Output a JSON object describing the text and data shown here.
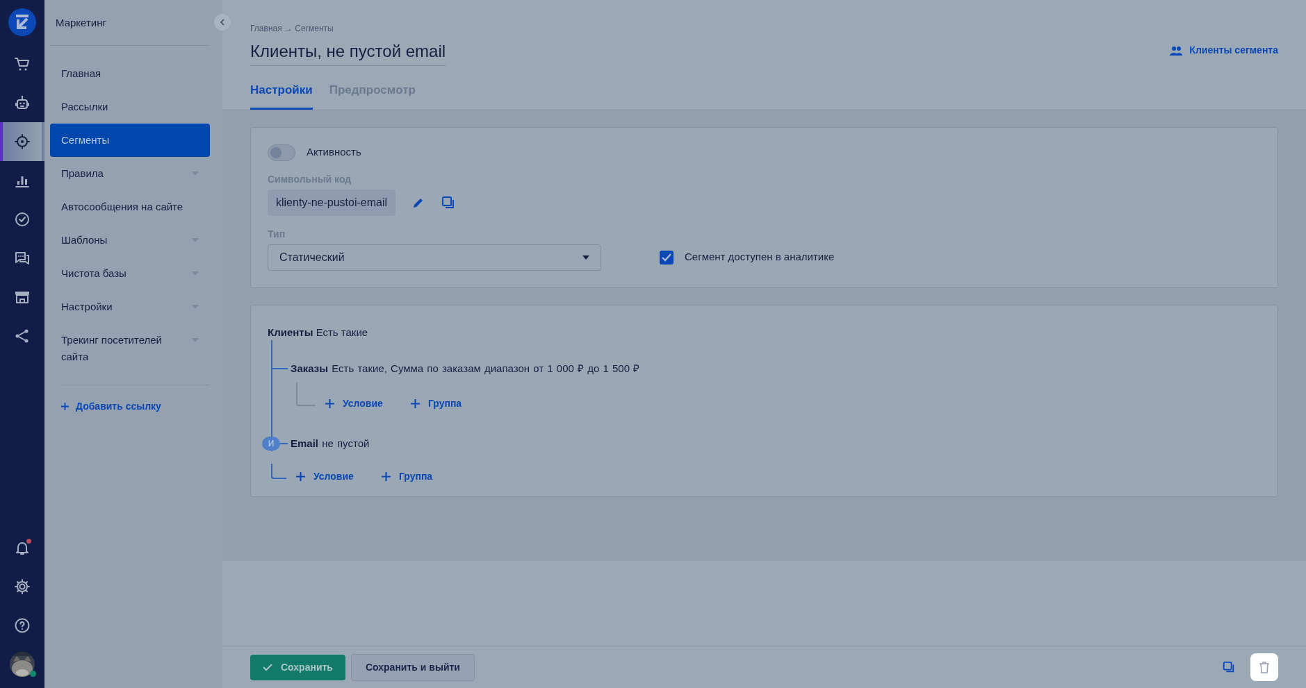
{
  "rail": {
    "items": [
      {
        "kind": "cart",
        "selected": false
      },
      {
        "kind": "robot",
        "selected": false
      },
      {
        "kind": "target",
        "selected": true
      },
      {
        "kind": "chart",
        "selected": false
      },
      {
        "kind": "check",
        "selected": false
      },
      {
        "kind": "chat",
        "selected": false
      },
      {
        "kind": "store",
        "selected": false
      },
      {
        "kind": "share",
        "selected": false
      }
    ],
    "bottom": [
      {
        "kind": "bell",
        "notification": true
      },
      {
        "kind": "gear",
        "notification": false
      },
      {
        "kind": "help",
        "notification": false
      },
      {
        "kind": "avatar",
        "notification": true
      }
    ]
  },
  "sidebar": {
    "title": "Маркетинг",
    "items": [
      {
        "label": "Главная",
        "selected": false,
        "expandable": false
      },
      {
        "label": "Рассылки",
        "selected": false,
        "expandable": false
      },
      {
        "label": "Сегменты",
        "selected": true,
        "expandable": false
      },
      {
        "label": "Правила",
        "selected": false,
        "expandable": true
      },
      {
        "label": "Автосообщения на сайте",
        "selected": false,
        "expandable": false
      },
      {
        "label": "Шаблоны",
        "selected": false,
        "expandable": true
      },
      {
        "label": "Чистота базы",
        "selected": false,
        "expandable": true
      },
      {
        "label": "Настройки",
        "selected": false,
        "expandable": true
      },
      {
        "label": "Трекинг посетителей сайта",
        "selected": false,
        "expandable": true
      }
    ],
    "add_link": "Добавить ссылку"
  },
  "breadcrumb": "Главная → Сегменты",
  "title": "Клиенты, не пустой email",
  "header_link": "Клиенты сегмента",
  "tabs": [
    {
      "label": "Настройки",
      "selected": true
    },
    {
      "label": "Предпросмотр",
      "selected": false
    }
  ],
  "settings": {
    "active": {
      "label": "Активность",
      "on": false
    },
    "code": {
      "label": "Символьный код",
      "value": "klienty-ne-pustoi-email"
    },
    "type": {
      "label": "Тип",
      "value": "Статический"
    },
    "analytics": {
      "label": "Сегмент доступен в аналитике",
      "checked": true
    }
  },
  "conditions": {
    "entity": "Клиенты",
    "text": "Есть такие",
    "children": [
      {
        "entity": "Заказы",
        "text": "Есть такие, Сумма по заказам диапазон от 1 000 ₽ до 1 500 ₽",
        "actions": [
          "Условие",
          "Группа"
        ]
      },
      {
        "entity": "Email",
        "text": "не пустой",
        "connector": "И"
      }
    ],
    "actions": [
      "Условие",
      "Группа"
    ]
  },
  "footer": {
    "buttons": [
      {
        "label": "Сохранить",
        "kind": "primary"
      },
      {
        "label": "Сохранить и выйти",
        "kind": "secondary"
      }
    ]
  }
}
